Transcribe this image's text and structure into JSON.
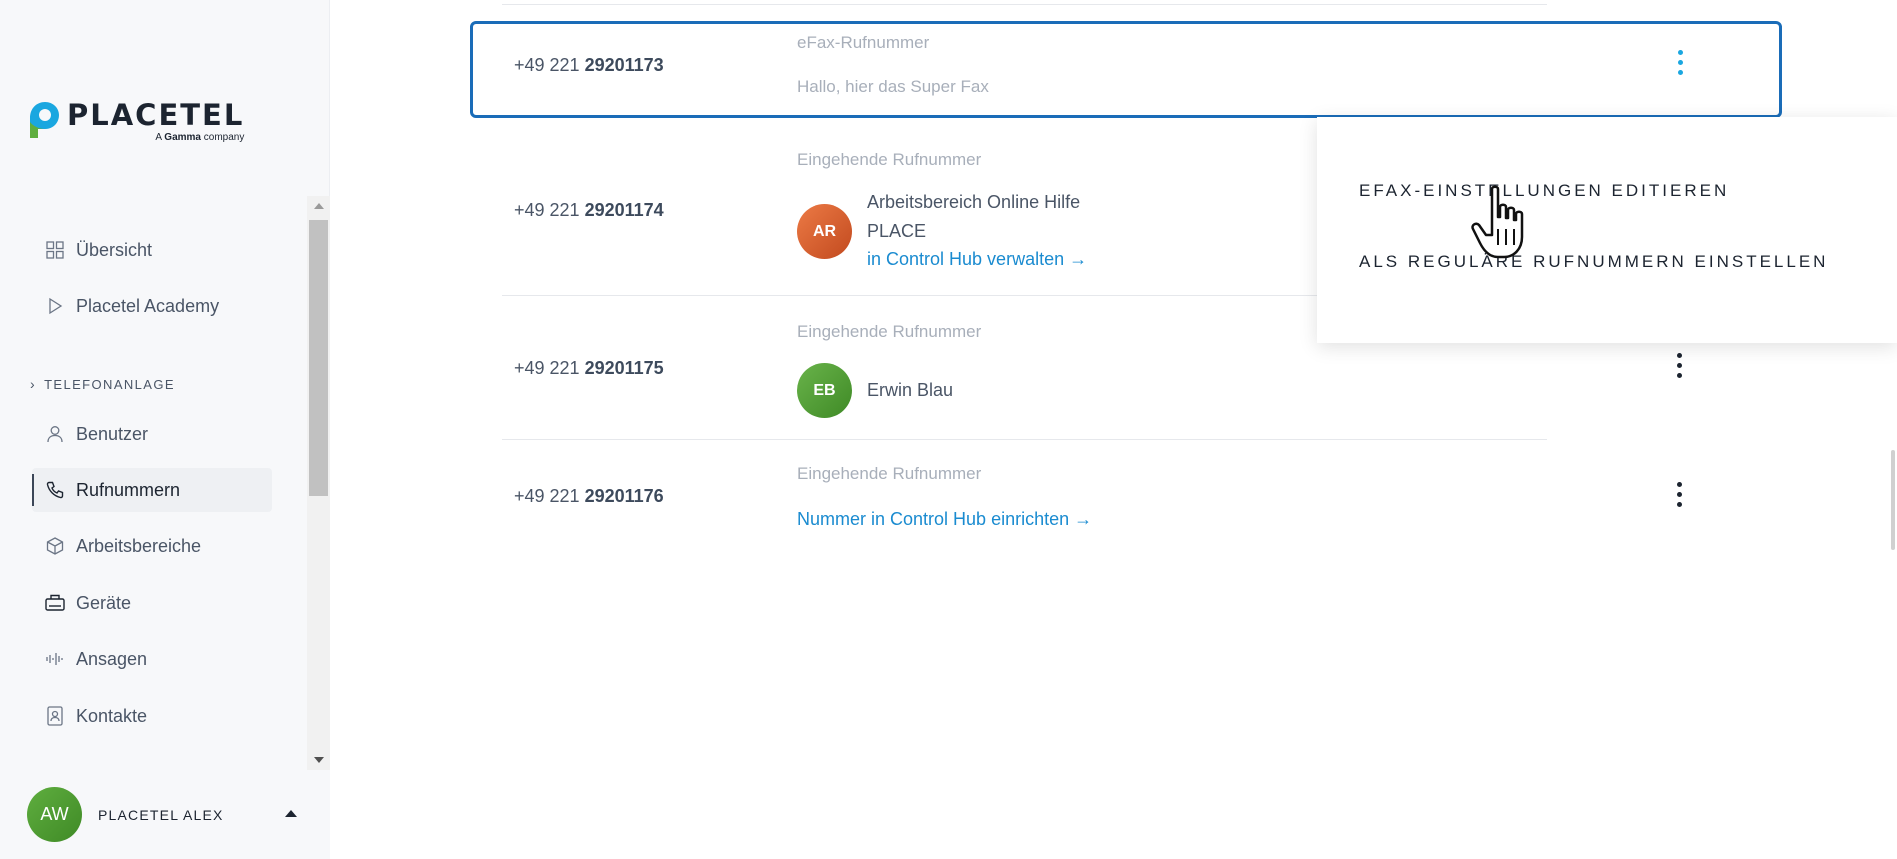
{
  "brand": {
    "name": "PLACETEL",
    "tagline_prefix": "A",
    "tagline_bold": "Gamma",
    "tagline_suffix": "company"
  },
  "sidebar": {
    "items_top": [
      {
        "label": "Übersicht",
        "icon": "grid-icon"
      },
      {
        "label": "Placetel Academy",
        "icon": "play-icon"
      }
    ],
    "section": "TELEFONANLAGE",
    "items": [
      {
        "label": "Benutzer",
        "icon": "user-icon"
      },
      {
        "label": "Rufnummern",
        "icon": "phone-icon",
        "active": true
      },
      {
        "label": "Arbeitsbereiche",
        "icon": "cube-icon"
      },
      {
        "label": "Geräte",
        "icon": "device-icon"
      },
      {
        "label": "Ansagen",
        "icon": "waveform-icon"
      },
      {
        "label": "Kontakte",
        "icon": "contacts-icon"
      }
    ]
  },
  "user": {
    "initials": "AW",
    "name": "PLACETEL ALEX"
  },
  "numbers": [
    {
      "prefix": "+49 221",
      "number": "29201173",
      "type": "eFax-Rufnummer",
      "description": "Hallo, hier das Super Fax",
      "selected": true
    },
    {
      "prefix": "+49 221",
      "number": "29201174",
      "type": "Eingehende Rufnummer",
      "avatar": "AR",
      "line1": "Arbeitsbereich Online Hilfe",
      "line2": "PLACE",
      "link": "in Control Hub verwalten →"
    },
    {
      "prefix": "+49 221",
      "number": "29201175",
      "type": "Eingehende Rufnummer",
      "avatar": "EB",
      "line1": "Erwin Blau"
    },
    {
      "prefix": "+49 221",
      "number": "29201176",
      "type": "Eingehende Rufnummer",
      "link": "Nummer in Control Hub einrichten →"
    }
  ],
  "menu": {
    "items": [
      "EFAX-EINSTELLUNGEN EDITIEREN",
      "ALS REGULÄRE RUFNUMMERN EINSTELLEN"
    ]
  },
  "colors": {
    "accent": "#1a6cb8",
    "link": "#1a8bd0",
    "kebab_active": "#1aa7e0"
  }
}
